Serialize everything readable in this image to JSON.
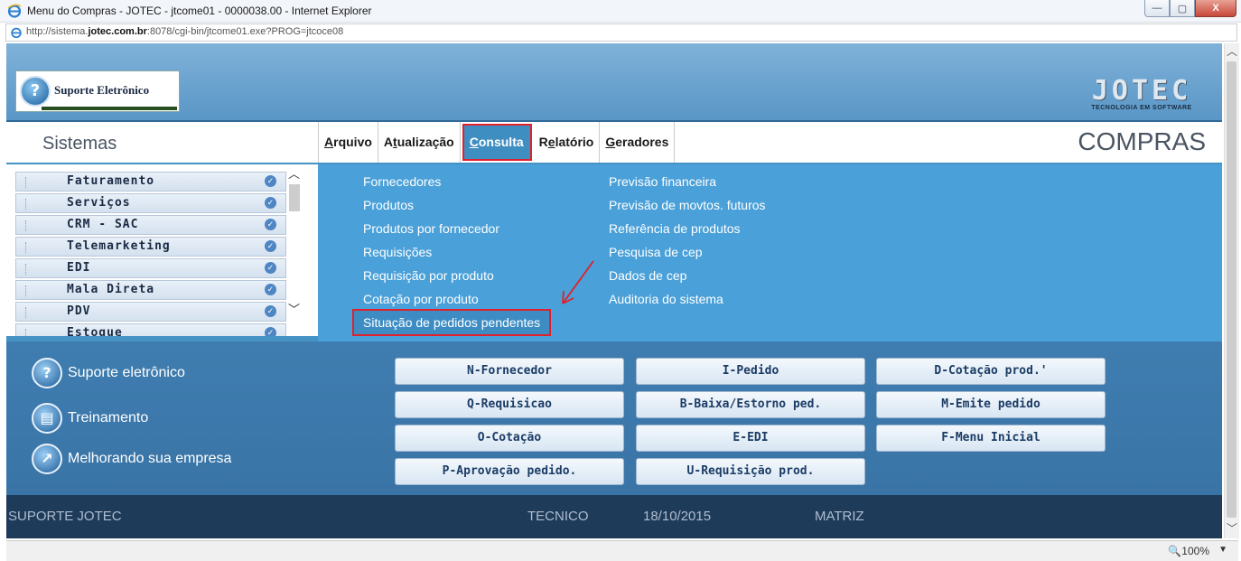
{
  "window": {
    "title": "Menu do Compras - JOTEC - jtcome01 - 0000038.00 - Internet Explorer",
    "minimize_label": "—",
    "maximize_label": "▢",
    "close_label": "X"
  },
  "address": {
    "prefix": "http://sistema.",
    "domain": "jotec.com.br",
    "suffix": ":8078/cgi-bin/jtcome01.exe?PROG=jtcoce08"
  },
  "header": {
    "brand": "Suporte Eletrônico",
    "logo_word": "JOTEC",
    "logo_sub": "TECNOLOGIA EM SOFTWARE"
  },
  "nav": {
    "systems_title": "Sistemas",
    "menu": [
      {
        "pre": "",
        "u": "A",
        "post": "rquivo"
      },
      {
        "pre": "A",
        "u": "t",
        "post": "ualização"
      },
      {
        "pre": "",
        "u": "C",
        "post": "onsulta"
      },
      {
        "pre": "R",
        "u": "e",
        "post": "latório"
      },
      {
        "pre": "",
        "u": "G",
        "post": "eradores"
      }
    ],
    "active_menu": "Consulta",
    "module": "COMPRAS"
  },
  "systems": [
    "Faturamento",
    "Serviços",
    "CRM - SAC",
    "Telemarketing",
    "EDI",
    "Mala Direta",
    "PDV",
    "Estoque"
  ],
  "dropdown": {
    "col1": [
      "Fornecedores",
      "Produtos",
      "Produtos por fornecedor",
      "Requisições",
      "Requisição por produto",
      "Cotação por produto",
      "Situação de pedidos pendentes"
    ],
    "col2": [
      "Previsão financeira",
      "Previsão de movtos. futuros",
      "Referência de produtos",
      "Pesquisa de cep",
      "Dados de cep",
      "Auditoria do sistema"
    ],
    "highlighted": "Situação de pedidos pendentes"
  },
  "support_links": [
    "Suporte eletrônico",
    "Treinamento",
    "Melhorando sua empresa"
  ],
  "buttons": [
    "N-Fornecedor",
    "I-Pedido",
    "D-Cotação prod.'",
    "Q-Requisicao",
    "B-Baixa/Estorno ped.",
    "M-Emite pedido",
    "O-Cotação",
    "E-EDI",
    "F-Menu Inicial",
    "P-Aprovação pedido.",
    "U-Requisição prod."
  ],
  "status": {
    "company": "SUPORTE JOTEC",
    "user": "TECNICO",
    "date": "18/10/2015",
    "branch": "MATRIZ"
  },
  "browser_status": {
    "zoom": "100%"
  },
  "colors": {
    "accent": "#4aa0d8",
    "highlight_border": "#e0202a",
    "status_bar": "#1f3b5a"
  }
}
